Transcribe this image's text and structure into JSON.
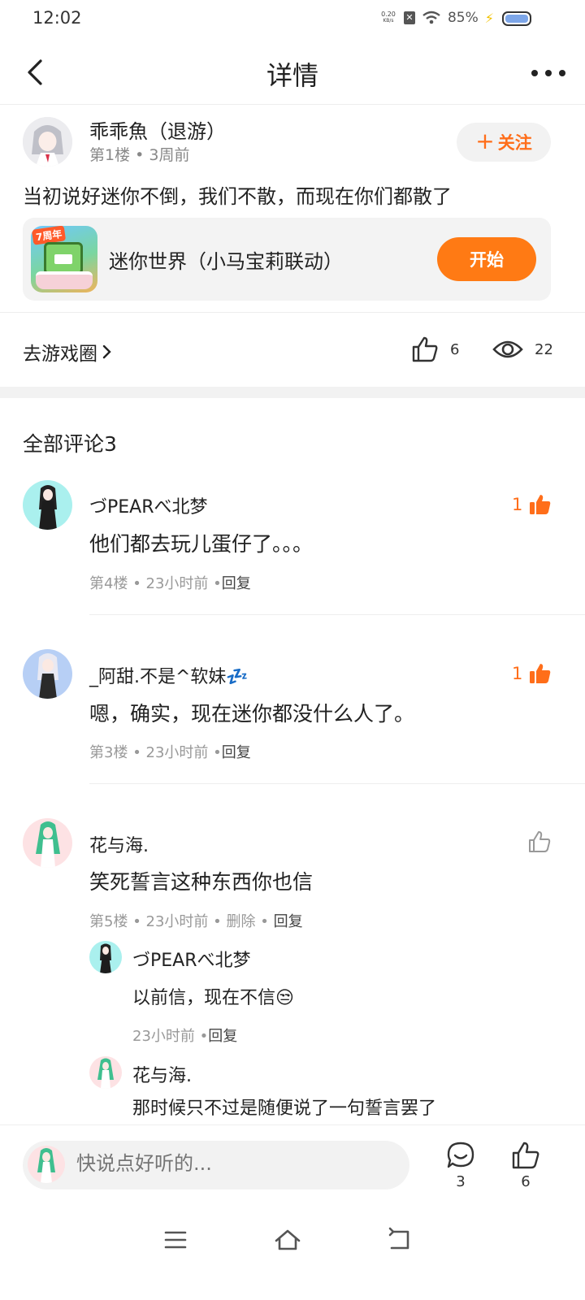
{
  "status_bar": {
    "time": "12:02",
    "net_speed_value": "0.20",
    "net_speed_unit": "KB/s",
    "battery": "85%",
    "battery_icon": "battery-icon",
    "wifi_icon": "wifi-icon"
  },
  "header": {
    "title": "详情",
    "back_icon": "back-arrow-icon",
    "more_icon": "more-dots-icon"
  },
  "post": {
    "author": "乖乖魚（退游）",
    "floor": "第1楼",
    "time": "3周前",
    "follow_label": "关注",
    "content": "当初说好迷你不倒，我们不散，而现在你们都散了",
    "game": {
      "name": "迷你世界（小马宝莉联动）",
      "icon_badge": "7周年",
      "start_label": "开始"
    },
    "circle_link": "去游戏圈",
    "likes": "6",
    "views": "22"
  },
  "comments_header": "全部评论3",
  "comments": [
    {
      "name": "づPEARべ北梦",
      "text": "他们都去玩儿蛋仔了。。。",
      "floor": "第4楼",
      "time": "23小时前",
      "reply": "回复",
      "likes": "1",
      "liked": true
    },
    {
      "name": "_阿甜.不是^软妹💤",
      "text": "嗯，确实，现在迷你都没什么人了。",
      "floor": "第3楼",
      "time": "23小时前",
      "reply": "回复",
      "likes": "1",
      "liked": true
    },
    {
      "name": "花与海.",
      "text": "笑死誓言这种东西你也信",
      "floor": "第5楼",
      "time": "23小时前",
      "delete": "删除",
      "reply": "回复",
      "likes": "",
      "liked": false,
      "replies": [
        {
          "name": "づPEARべ北梦",
          "text": "以前信，现在不信😒",
          "time": "23小时前",
          "reply": "回复"
        },
        {
          "name": "花与海.",
          "text": "那时候只不过是随便说了一句誓言罢了"
        }
      ]
    }
  ],
  "bottom_bar": {
    "input_placeholder": "快说点好听的...",
    "comment_count": "3",
    "like_count": "6"
  },
  "colors": {
    "accent": "#ff7a14",
    "follow_text": "#ff6e1a"
  }
}
